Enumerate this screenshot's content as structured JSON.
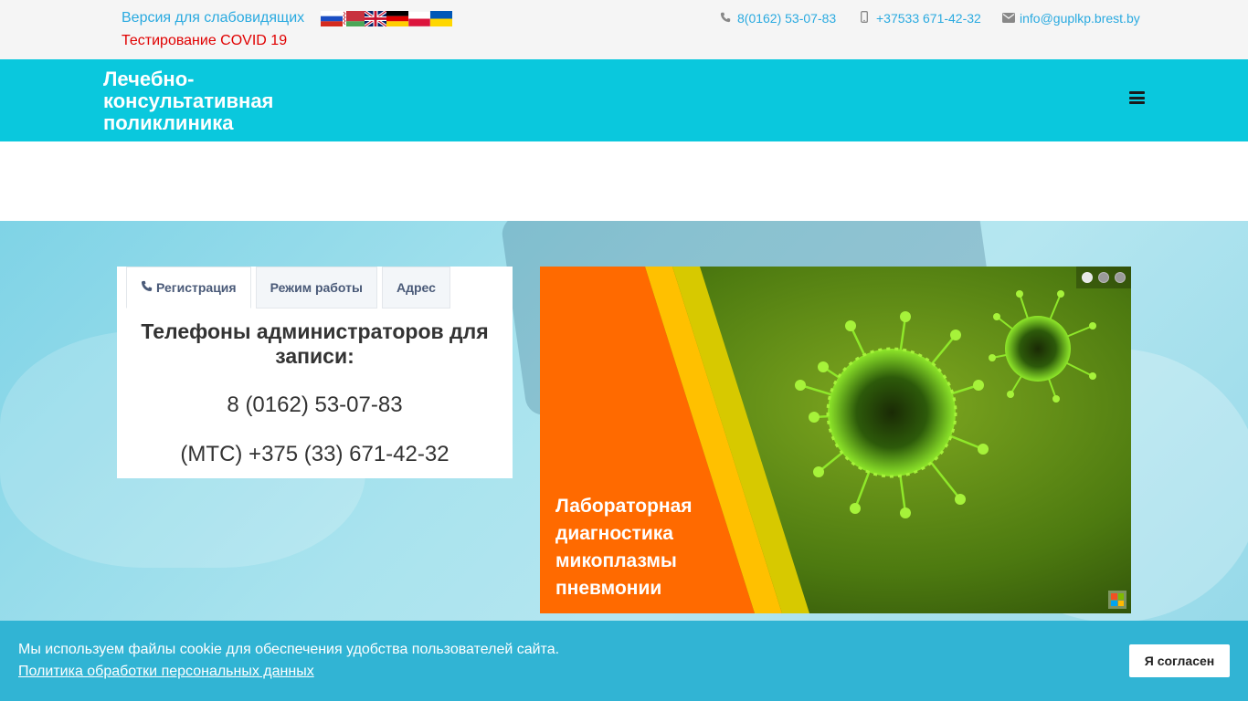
{
  "topbar": {
    "vision_link": "Версия для слабовидящих",
    "covid_link": "Тестирование COVID 19",
    "flags": [
      "russian-flag",
      "belarusian-flag",
      "english-flag",
      "german-flag",
      "polish-flag",
      "ukrainian-flag"
    ],
    "contacts": [
      {
        "icon": "phone-icon",
        "text": "8(0162) 53-07-83"
      },
      {
        "icon": "mobile-icon",
        "text": "+37533 671-42-32"
      },
      {
        "icon": "envelope-icon",
        "text": "info@guplkp.brest.by"
      }
    ]
  },
  "header": {
    "brand": "Лечебно-консультативная поликлиника",
    "menu_icon": "hamburger-menu-icon"
  },
  "panel": {
    "tabs": [
      {
        "label": "Регистрация",
        "active": true,
        "icon": "phone-icon"
      },
      {
        "label": "Режим работы",
        "active": false
      },
      {
        "label": "Адрес",
        "active": false
      }
    ],
    "title": "Телефоны администраторов для записи:",
    "phone1": "8 (0162) 53-07-83",
    "phone2": "(МТС) +375 (33) 671-42-32"
  },
  "slider": {
    "caption": "Лабораторная диагностика микоплазмы пневмонии",
    "dots": 3,
    "active_dot": 0
  },
  "cookie": {
    "text": "Мы используем файлы cookie для обеспечения удобства пользователей сайта.",
    "link": "Политика обработки персональных данных",
    "button": "Я согласен"
  },
  "colors": {
    "header_bg": "#0ac8dd",
    "link": "#2aaae0",
    "covid": "#e00000",
    "cookie_bg": "#31b4d4",
    "slide_orange": "#ff6a00",
    "slide_yellow": "#ffc000",
    "virus_green": "#7ddc1f"
  }
}
